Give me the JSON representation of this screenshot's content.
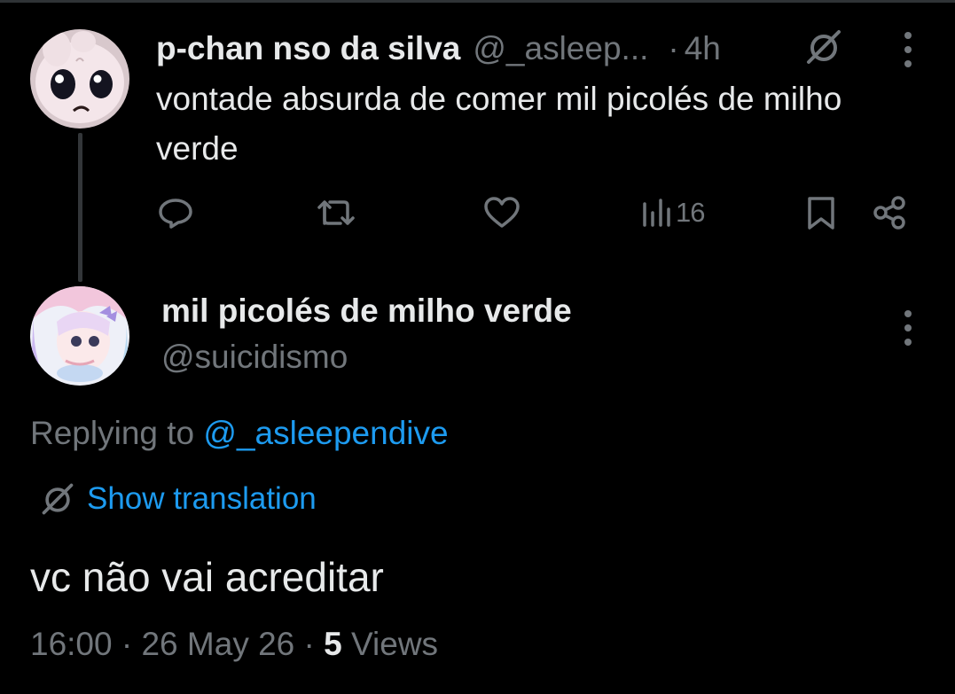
{
  "parent_tweet": {
    "display_name": "p-chan nso da silva",
    "handle": "@_asleep...",
    "separator": "·",
    "time": "4h",
    "text": "vontade absurda de comer mil picolés de milho verde",
    "actions": {
      "reply_icon": "reply-icon",
      "retweet_icon": "retweet-icon",
      "like_icon": "heart-icon",
      "views_icon": "views-icon",
      "views_count": "16",
      "bookmark_icon": "bookmark-icon",
      "share_icon": "share-icon"
    }
  },
  "reply_tweet": {
    "display_name": "mil picolés de milho verde",
    "handle": "@suicidismo",
    "replying_prefix": "Replying to ",
    "replying_to": "@_asleependive",
    "translate_label": "Show translation",
    "text": "vc não vai acreditar",
    "time": "16:00",
    "date": "26 May 26",
    "views_count": "5",
    "views_label": "Views",
    "separator": "·"
  },
  "colors": {
    "background": "#000000",
    "primary_text": "#e7e9ea",
    "secondary_text": "#71767b",
    "accent": "#1d9bf0"
  }
}
